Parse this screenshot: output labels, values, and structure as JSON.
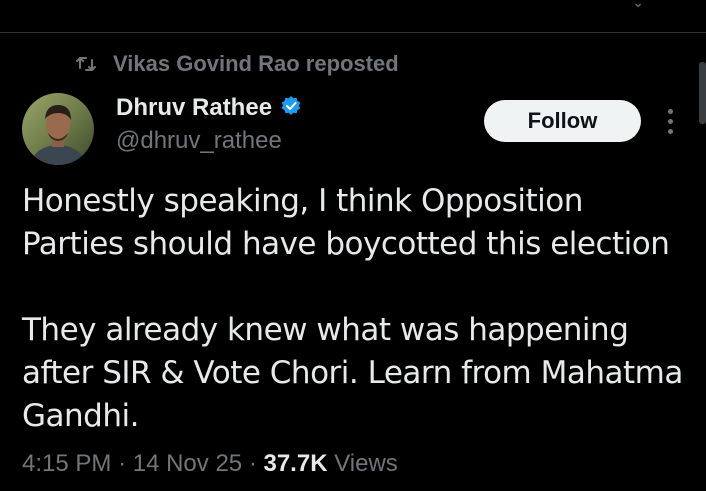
{
  "repost": {
    "text": "Vikas Govind Rao reposted",
    "icon": "repost-icon"
  },
  "author": {
    "display_name": "Dhruv Rathee",
    "handle": "@dhruv_rathee",
    "verified": true,
    "verified_color": "#1d9bf0",
    "avatar_icon": "avatar"
  },
  "actions": {
    "follow_label": "Follow",
    "more_icon": "more-vertical-icon"
  },
  "tweet": {
    "paragraph_1_line_1": "Honestly speaking, I think Opposition",
    "paragraph_1_line_2": "Parties should have boycotted this election",
    "paragraph_2_line_1": "They already knew what was happening",
    "paragraph_2_line_2": "after SIR & Vote Chori. Learn from Mahatma",
    "paragraph_2_line_3": "Gandhi."
  },
  "meta": {
    "time": "4:15 PM",
    "date": "14 Nov 25",
    "separator": "·",
    "views_count": "37.7K",
    "views_label": "Views"
  },
  "colors": {
    "background": "#000000",
    "text_primary": "#e7e9ea",
    "text_secondary": "#71767b",
    "follow_bg": "#eff3f4",
    "divider": "#2f3336"
  }
}
